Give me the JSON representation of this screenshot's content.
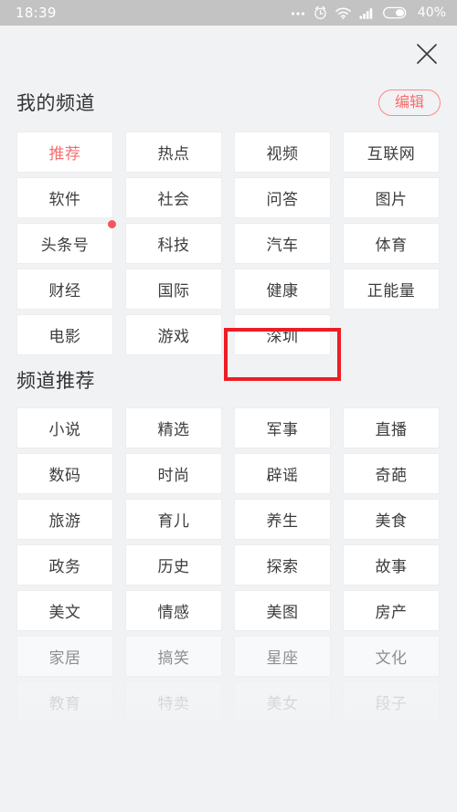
{
  "status_bar": {
    "time": "18:39",
    "battery_text": "40%",
    "battery_level": 40,
    "icons": [
      "more-dots-icon",
      "alarm-clock-icon",
      "wifi-icon",
      "signal-bars-icon",
      "battery-icon"
    ],
    "background_color": "#c3c3c3",
    "foreground_color": "#ffffff"
  },
  "header": {
    "close_icon": "close-icon"
  },
  "my_channels": {
    "title": "我的频道",
    "edit_label": "编辑",
    "accent_color": "#f96d6d",
    "tiles": [
      {
        "label": "推荐",
        "active": true,
        "badge": false
      },
      {
        "label": "热点",
        "active": false,
        "badge": false
      },
      {
        "label": "视频",
        "active": false,
        "badge": false
      },
      {
        "label": "互联网",
        "active": false,
        "badge": false
      },
      {
        "label": "软件",
        "active": false,
        "badge": false
      },
      {
        "label": "社会",
        "active": false,
        "badge": false
      },
      {
        "label": "问答",
        "active": false,
        "badge": false
      },
      {
        "label": "图片",
        "active": false,
        "badge": false
      },
      {
        "label": "头条号",
        "active": false,
        "badge": true
      },
      {
        "label": "科技",
        "active": false,
        "badge": false
      },
      {
        "label": "汽车",
        "active": false,
        "badge": false
      },
      {
        "label": "体育",
        "active": false,
        "badge": false
      },
      {
        "label": "财经",
        "active": false,
        "badge": false
      },
      {
        "label": "国际",
        "active": false,
        "badge": false
      },
      {
        "label": "健康",
        "active": false,
        "badge": false
      },
      {
        "label": "正能量",
        "active": false,
        "badge": false
      },
      {
        "label": "电影",
        "active": false,
        "badge": false
      },
      {
        "label": "游戏",
        "active": false,
        "badge": false
      },
      {
        "label": "深圳",
        "active": false,
        "badge": false
      }
    ]
  },
  "recommended_channels": {
    "title": "频道推荐",
    "tiles": [
      {
        "label": "小说",
        "fade": 0
      },
      {
        "label": "精选",
        "fade": 0
      },
      {
        "label": "军事",
        "fade": 0
      },
      {
        "label": "直播",
        "fade": 0
      },
      {
        "label": "数码",
        "fade": 0
      },
      {
        "label": "时尚",
        "fade": 0
      },
      {
        "label": "辟谣",
        "fade": 0
      },
      {
        "label": "奇葩",
        "fade": 0
      },
      {
        "label": "旅游",
        "fade": 0
      },
      {
        "label": "育儿",
        "fade": 0
      },
      {
        "label": "养生",
        "fade": 0
      },
      {
        "label": "美食",
        "fade": 0
      },
      {
        "label": "政务",
        "fade": 0
      },
      {
        "label": "历史",
        "fade": 0
      },
      {
        "label": "探索",
        "fade": 0
      },
      {
        "label": "故事",
        "fade": 0
      },
      {
        "label": "美文",
        "fade": 0
      },
      {
        "label": "情感",
        "fade": 0
      },
      {
        "label": "美图",
        "fade": 0
      },
      {
        "label": "房产",
        "fade": 0
      },
      {
        "label": "家居",
        "fade": 1
      },
      {
        "label": "搞笑",
        "fade": 1
      },
      {
        "label": "星座",
        "fade": 1
      },
      {
        "label": "文化",
        "fade": 1
      },
      {
        "label": "教育",
        "fade": 2
      },
      {
        "label": "特卖",
        "fade": 2
      },
      {
        "label": "美女",
        "fade": 2
      },
      {
        "label": "段子",
        "fade": 2
      }
    ]
  },
  "annotation": {
    "target_label": "深圳",
    "color": "#ee1c25"
  }
}
